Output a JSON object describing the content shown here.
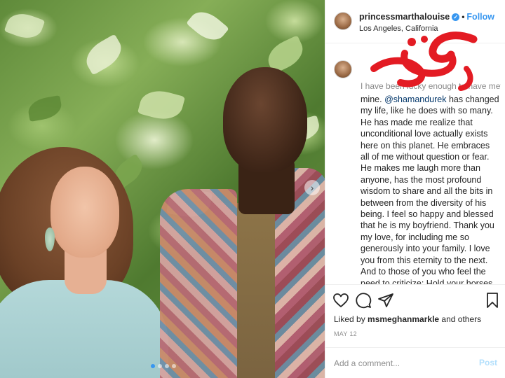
{
  "post": {
    "username": "princessmarthalouise",
    "separator": "•",
    "follow_label": "Follow",
    "location": "Los Angeles, California",
    "caption_overlap": "I have been lucky enough to have met",
    "caption_lead": "mine.",
    "mention": "@shamandurek",
    "caption_body": " has changed my life, like he does with so many. He has made me realize that unconditional love actually exists here on this planet. He embraces all of me without question or fear. He makes me laugh more than anyone, has the most profound wisdom to share and all the bits in between from the diversity of his being. I feel so happy and blessed that he is my boyfriend. Thank you my love, for including me so generously into your family. I love you from this eternity to the next.",
    "caption_body2": "And to those of you who feel the need to criticize: Hold your horses. It is not up to you to choose for me or to",
    "liked_by_prefix": "Liked by ",
    "liked_by_user": "msmeghanmarkle",
    "liked_by_suffix": " and others",
    "date": "MAY 12",
    "comment_placeholder": "Add a comment...",
    "post_label": "Post"
  },
  "icons": {
    "heart": "heart-icon",
    "comment": "comment-icon",
    "share": "share-icon",
    "save": "bookmark-icon",
    "verified": "verified-badge-icon",
    "carousel_next": "chevron-right-icon"
  },
  "colors": {
    "link_blue": "#3897f0",
    "logo_red": "#e31b23",
    "muted": "#8e8e8e"
  }
}
